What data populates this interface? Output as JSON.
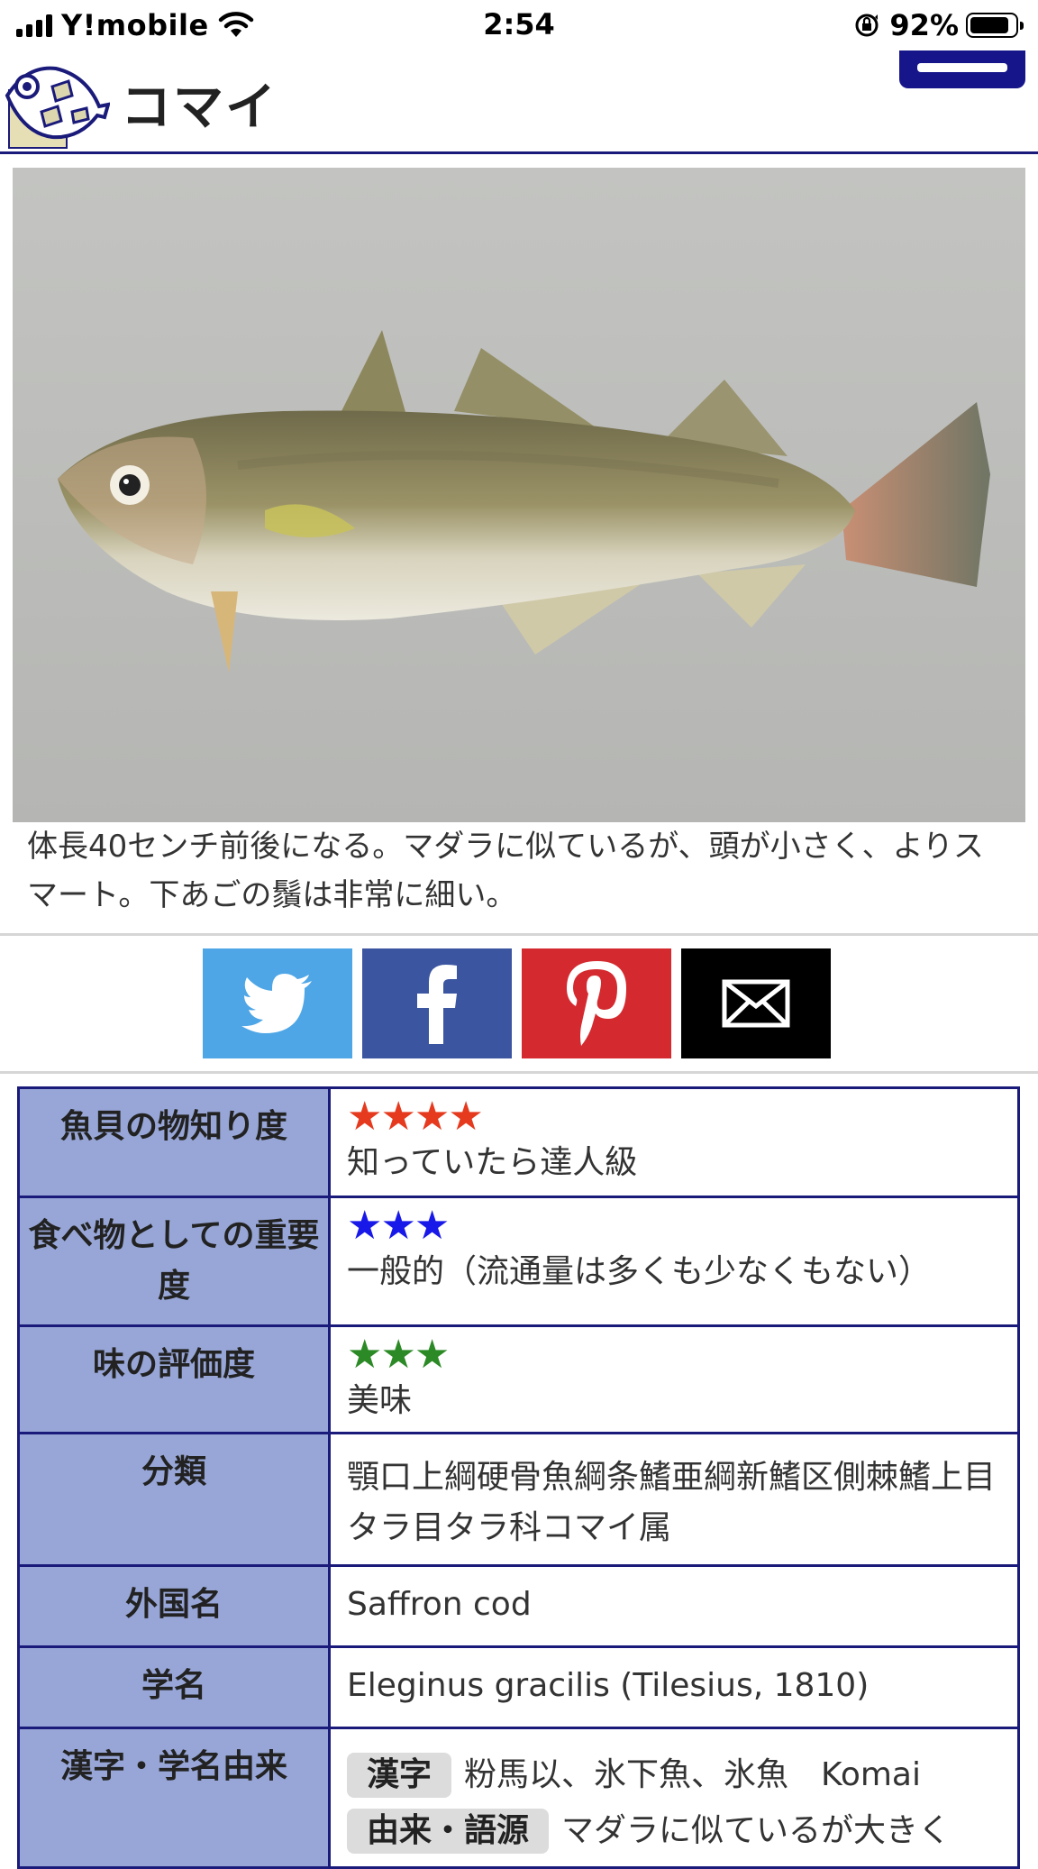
{
  "status_bar": {
    "carrier": "Y!mobile",
    "time": "2:54",
    "battery": "92%"
  },
  "header": {
    "title": "コマイ"
  },
  "description": "体長40センチ前後になる。マダラに似ているが、頭が小さく、よりスマート。下あごの鬚は非常に細い。",
  "ratings": [
    {
      "label": "魚貝の物知り度",
      "stars": "★★★★",
      "star_color": "#e53a1e",
      "text": "知っていたら達人級"
    },
    {
      "label": "食べ物としての重要度",
      "stars": "★★★",
      "star_color": "#1818e8",
      "text": "一般的（流通量は多くも少なくもない）"
    },
    {
      "label": "味の評価度",
      "stars": "★★★",
      "star_color": "#2c8a26",
      "text": "美味"
    }
  ],
  "details": {
    "classification_label": "分類",
    "classification_value": "顎口上綱硬骨魚綱条鰭亜綱新鰭区側棘鰭上目タラ目タラ科コマイ属",
    "foreign_name_label": "外国名",
    "foreign_name_value": "Saffron cod",
    "scientific_name_label": "学名",
    "scientific_name_value": "Eleginus gracilis (Tilesius, 1810)",
    "kanji_label": "漢字・学名由来",
    "kanji_tag": "漢字",
    "kanji_value": "粉馬以、氷下魚、氷魚　Komai",
    "origin_tag": "由来・語源",
    "origin_value": "マダラに似ているが大きく"
  },
  "colors": {
    "header_rule": "#1a1a7a",
    "table_header_bg": "#97a6d6",
    "twitter": "#4ea6e6",
    "facebook": "#3b55a0",
    "pinterest": "#d42a2f",
    "mail": "#000000"
  },
  "icons": [
    "signal-icon",
    "wifi-icon",
    "orientation-lock-icon",
    "battery-icon",
    "site-logo-icon",
    "menu-icon",
    "twitter-icon",
    "facebook-icon",
    "pinterest-icon",
    "mail-icon"
  ]
}
